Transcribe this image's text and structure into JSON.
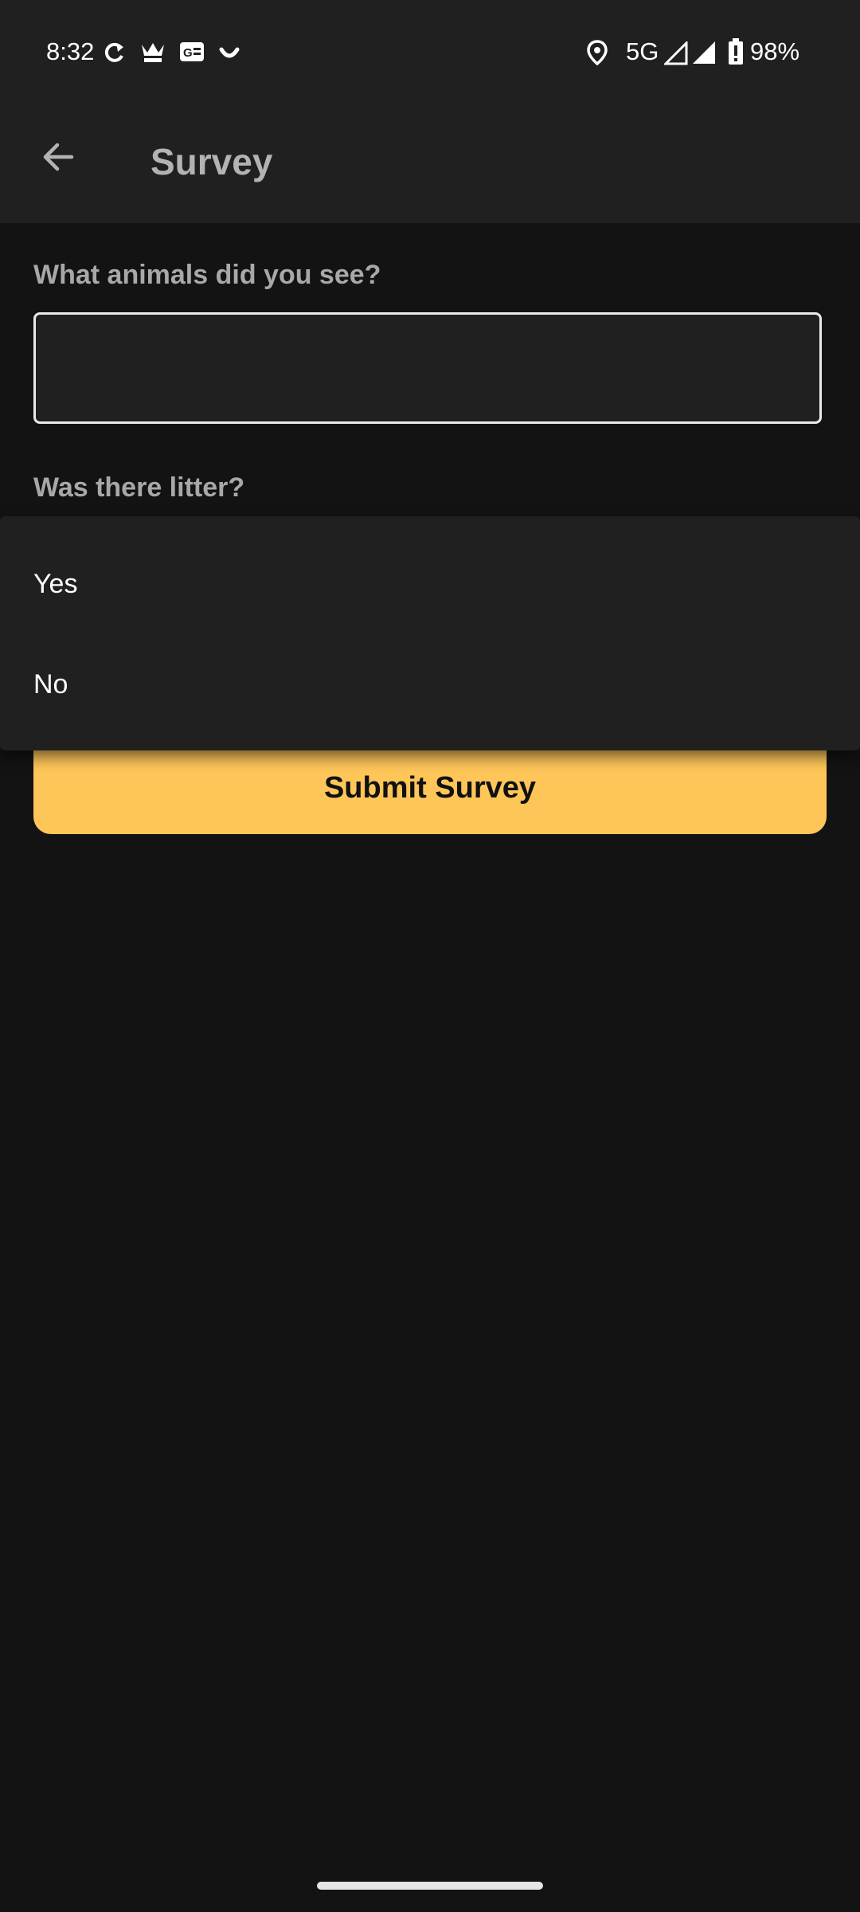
{
  "status_bar": {
    "time": "8:32",
    "left_icons": [
      "sync-icon",
      "fool-app-icon",
      "news-card-icon",
      "smile-icon"
    ],
    "network": "5G",
    "battery": "98%",
    "right_icons": [
      "location-icon",
      "signal-icon",
      "battery-icon"
    ]
  },
  "app_bar": {
    "title": "Survey",
    "back_icon": "arrow-back-icon"
  },
  "form": {
    "animals_label": "What animals did you see?",
    "animals_value": "",
    "litter_label": "Was there litter?",
    "litter_options": [
      "Yes",
      "No"
    ],
    "submit_label": "Submit Survey"
  },
  "colors": {
    "background": "#131313",
    "bar": "#202020",
    "accent": "#fec659",
    "label": "#a8a8a8"
  }
}
